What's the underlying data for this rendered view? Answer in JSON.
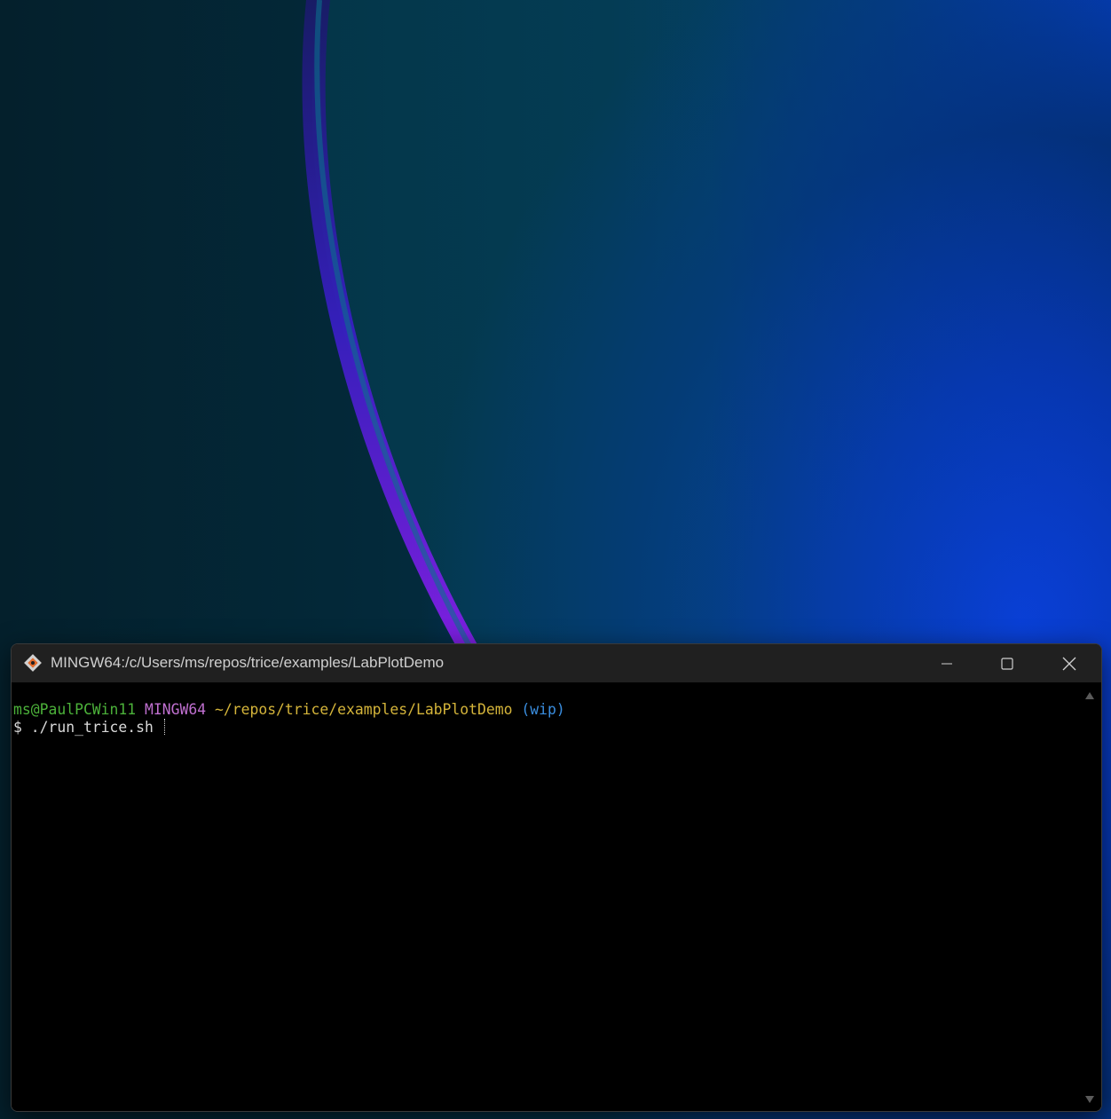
{
  "window": {
    "title": "MINGW64:/c/Users/ms/repos/trice/examples/LabPlotDemo"
  },
  "prompt": {
    "user_host": "ms@PaulPCWin11",
    "system": "MINGW64",
    "path": "~/repos/trice/examples/LabPlotDemo",
    "branch": "(wip)",
    "symbol": "$",
    "command": "./run_trice.sh"
  },
  "icons": {
    "app": "git-bash-icon",
    "minimize": "minimize-icon",
    "maximize": "maximize-icon",
    "close": "close-icon"
  },
  "colors": {
    "user_host": "#4cb23a",
    "system": "#c070d0",
    "path": "#d4b43a",
    "branch": "#3a8ee0",
    "titlebar": "#202020",
    "terminal_bg": "#000000"
  }
}
